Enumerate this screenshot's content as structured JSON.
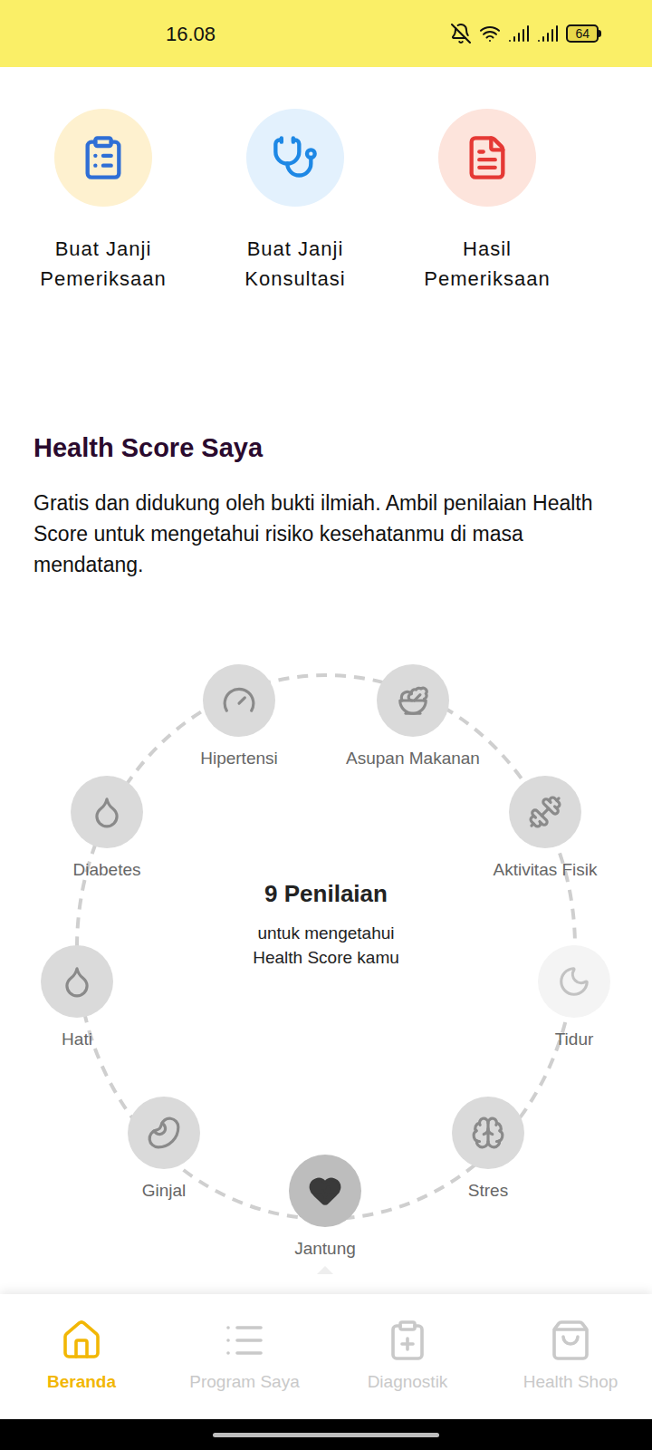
{
  "status_bar": {
    "time": "16.08",
    "battery": "64"
  },
  "quick_actions": [
    {
      "lines": [
        "Buat Janji",
        "Pemeriksaan"
      ]
    },
    {
      "lines": [
        "Buat Janji",
        "Konsultasi"
      ]
    },
    {
      "lines": [
        "Hasil",
        "Pemeriksaan"
      ]
    }
  ],
  "health_score": {
    "title": "Health Score Saya",
    "description": "Gratis dan didukung oleh bukti ilmiah. Ambil penilaian Health Score untuk mengetahui risiko kesehatanmu di masa mendatang.",
    "center_title": "9 Penilaian",
    "center_subtitle": [
      "untuk mengetahui",
      "Health Score kamu"
    ],
    "assessments": [
      {
        "label": "Hipertensi",
        "selected": false,
        "dimmed": false
      },
      {
        "label": "Asupan Makanan",
        "selected": false,
        "dimmed": false
      },
      {
        "label": "Aktivitas Fisik",
        "selected": false,
        "dimmed": false
      },
      {
        "label": "Tidur",
        "selected": false,
        "dimmed": true
      },
      {
        "label": "Stres",
        "selected": false,
        "dimmed": false
      },
      {
        "label": "Jantung",
        "selected": true,
        "dimmed": false
      },
      {
        "label": "Ginjal",
        "selected": false,
        "dimmed": false
      },
      {
        "label": "Hati",
        "selected": false,
        "dimmed": false
      },
      {
        "label": "Diabetes",
        "selected": false,
        "dimmed": false
      }
    ]
  },
  "nav": [
    {
      "label": "Beranda",
      "selected": true
    },
    {
      "label": "Program Saya",
      "selected": false
    },
    {
      "label": "Diagnostik",
      "selected": false
    },
    {
      "label": "Health Shop",
      "selected": false
    }
  ]
}
